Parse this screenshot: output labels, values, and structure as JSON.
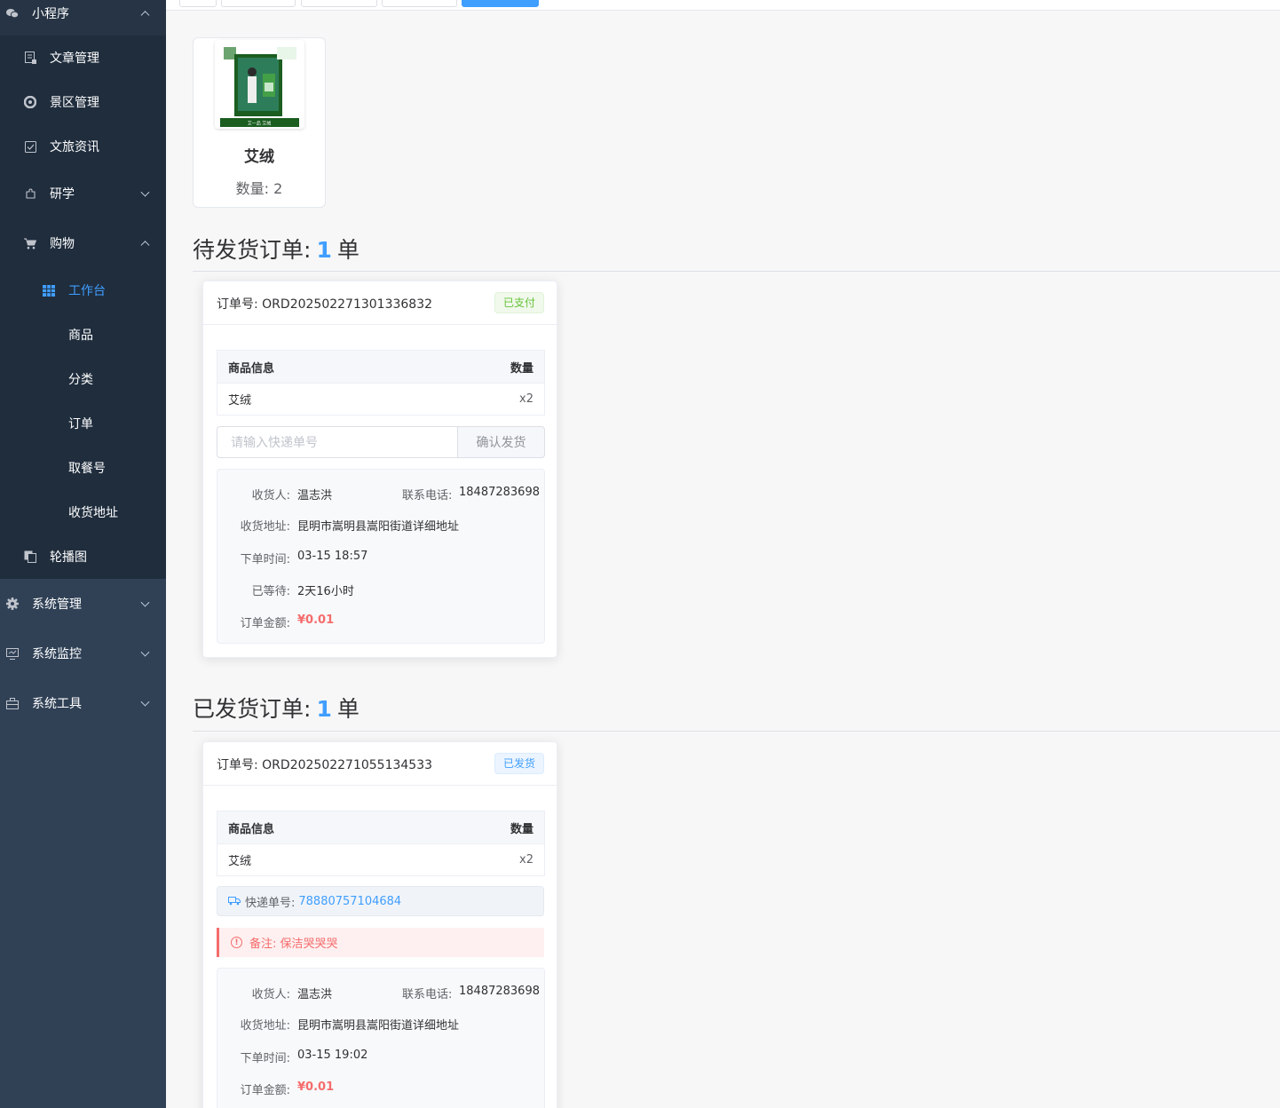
{
  "sidebar": {
    "top_label": "小程序",
    "items": [
      {
        "label": "文章管理",
        "icon": "document-icon"
      },
      {
        "label": "景区管理",
        "icon": "scenic-icon"
      },
      {
        "label": "文旅资讯",
        "icon": "checkbox-icon"
      },
      {
        "label": "研学",
        "icon": "puzzle-icon"
      },
      {
        "label": "购物",
        "icon": "cart-icon"
      },
      {
        "label": "工作台",
        "icon": "grid-icon"
      },
      {
        "label": "商品"
      },
      {
        "label": "分类"
      },
      {
        "label": "订单"
      },
      {
        "label": "取餐号"
      },
      {
        "label": "收货地址"
      },
      {
        "label": "轮播图",
        "icon": "copy-icon"
      },
      {
        "label": "系统管理",
        "icon": "gear-icon"
      },
      {
        "label": "系统监控",
        "icon": "monitor-icon"
      },
      {
        "label": "系统工具",
        "icon": "toolbox-icon"
      }
    ]
  },
  "product": {
    "name": "艾绒",
    "qty_label": "数量: 2",
    "image_text": "艾一品 艾绒"
  },
  "pending": {
    "title_prefix": "待发货订单:",
    "count": "1",
    "unit": "单",
    "order": {
      "order_no": "订单号: ORD202502271301336832",
      "status": "已支付",
      "table_head_item": "商品信息",
      "table_head_qty": "数量",
      "item_name": "艾绒",
      "item_qty": "x2",
      "tracking_placeholder": "请输入快递单号",
      "confirm_button": "确认发货",
      "receiver_label": "收货人:",
      "receiver": "温志洪",
      "phone_label": "联系电话:",
      "phone": "18487283698",
      "address_label": "收货地址:",
      "address": "昆明市嵩明县嵩阳街道详细地址",
      "order_time_label": "下单时间:",
      "order_time": "03-15 18:57",
      "waited_label": "已等待:",
      "waited": "2天16小时",
      "amount_label": "订单金额:",
      "amount": "¥0.01"
    }
  },
  "shipped": {
    "title_prefix": "已发货订单:",
    "count": "1",
    "unit": "单",
    "order": {
      "order_no": "订单号: ORD202502271055134533",
      "status": "已发货",
      "table_head_item": "商品信息",
      "table_head_qty": "数量",
      "item_name": "艾绒",
      "item_qty": "x2",
      "express_label": "快递单号:",
      "express_no": "78880757104684",
      "remark": "备注: 保洁哭哭哭",
      "receiver_label": "收货人:",
      "receiver": "温志洪",
      "phone_label": "联系电话:",
      "phone": "18487283698",
      "address_label": "收货地址:",
      "address": "昆明市嵩明县嵩阳街道详细地址",
      "order_time_label": "下单时间:",
      "order_time": "03-15 19:02",
      "amount_label": "订单金额:",
      "amount": "¥0.01"
    }
  },
  "colors": {
    "sidebar_bg": "#304156",
    "sidebar_sub_bg": "#1f2d3d",
    "accent": "#409eff",
    "success": "#67c23a",
    "danger": "#f56c6c"
  }
}
